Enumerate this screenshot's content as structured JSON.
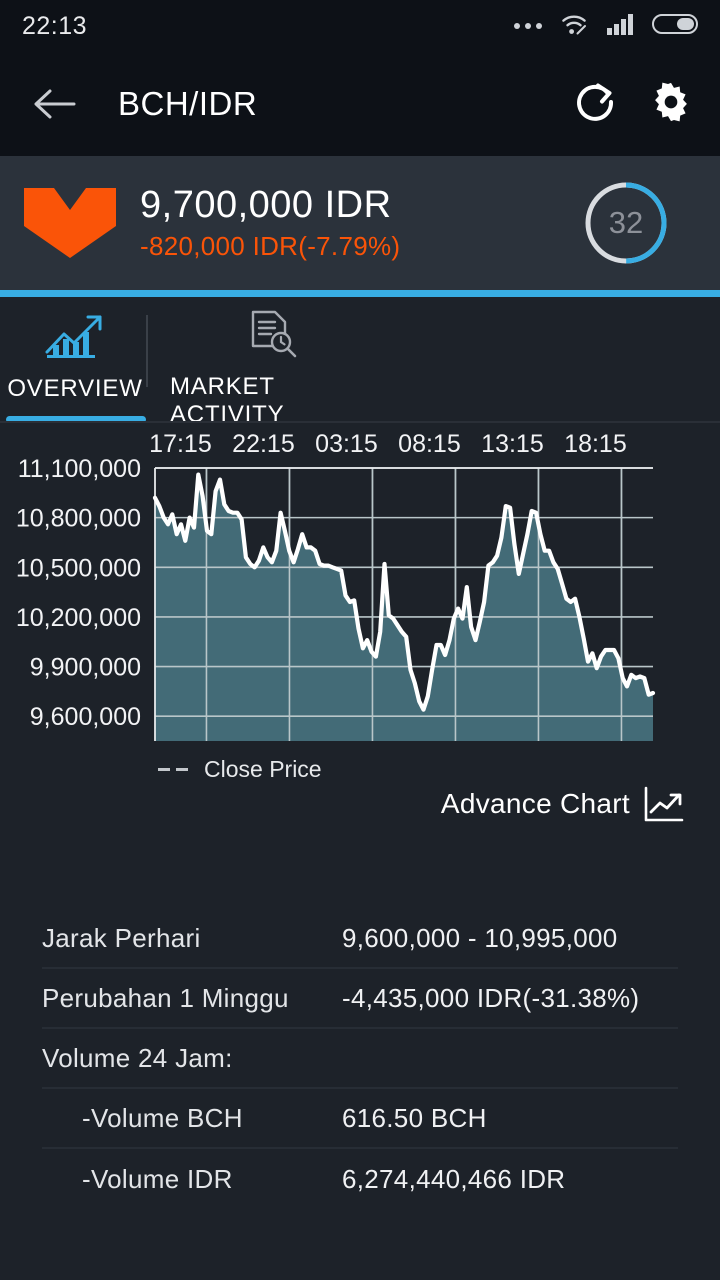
{
  "status_bar": {
    "time": "22:13",
    "icons": [
      "more-dots-icon",
      "wifi-icon",
      "signal-icon",
      "battery-icon"
    ]
  },
  "app_bar": {
    "back_icon": "back-arrow-icon",
    "title": "BCH/IDR",
    "refresh_icon": "refresh-icon",
    "settings_icon": "gear-icon"
  },
  "price_header": {
    "trend_icon": "down-chevron-icon",
    "price": "9,700,000 IDR",
    "change": "-820,000 IDR(-7.79%)",
    "change_color": "#fa5408",
    "countdown": "32",
    "countdown_progress_pct": 50,
    "accent_color": "#38ade3"
  },
  "tabs": [
    {
      "label": "OVERVIEW",
      "icon": "bar-chart-up-icon",
      "active": true
    },
    {
      "label": "MARKET ACTIVITY",
      "icon": "document-search-icon",
      "active": false
    }
  ],
  "chart_card": {
    "legend_label": "Close Price",
    "advance_chart_label": "Advance Chart",
    "advance_chart_icon": "trending-up-icon"
  },
  "chart_data": {
    "type": "area",
    "title": "",
    "xlabel": "",
    "ylabel": "",
    "series_name": "Close Price",
    "line_color": "#ffffff",
    "fill_color": "#436b77",
    "grid": true,
    "legend_position": "bottom-left",
    "ylim": [
      9450000,
      11100000
    ],
    "yticks": [
      11100000,
      10800000,
      10500000,
      10200000,
      9900000,
      9600000
    ],
    "ytick_labels": [
      "11,100,000",
      "10,800,000",
      "10,500,000",
      "10,200,000",
      "9,900,000",
      "9,600,000"
    ],
    "xtick_labels": [
      "17:15",
      "22:15",
      "03:15",
      "08:15",
      "13:15",
      "18:15"
    ],
    "values": [
      10920000,
      10870000,
      10800000,
      10760000,
      10820000,
      10700000,
      10760000,
      10660000,
      10800000,
      10740000,
      11060000,
      10930000,
      10720000,
      10700000,
      10960000,
      11030000,
      10880000,
      10840000,
      10830000,
      10830000,
      10790000,
      10560000,
      10520000,
      10500000,
      10540000,
      10620000,
      10560000,
      10530000,
      10600000,
      10830000,
      10720000,
      10600000,
      10530000,
      10610000,
      10700000,
      10620000,
      10620000,
      10600000,
      10520000,
      10510000,
      10510000,
      10500000,
      10490000,
      10480000,
      10330000,
      10290000,
      10300000,
      10130000,
      10010000,
      10060000,
      9990000,
      9960000,
      10110000,
      10520000,
      10210000,
      10190000,
      10150000,
      10110000,
      10080000,
      9880000,
      9800000,
      9690000,
      9640000,
      9720000,
      9880000,
      10030000,
      10030000,
      9970000,
      10060000,
      10190000,
      10250000,
      10190000,
      10380000,
      10140000,
      10060000,
      10170000,
      10290000,
      10510000,
      10530000,
      10570000,
      10680000,
      10870000,
      10860000,
      10640000,
      10460000,
      10580000,
      10700000,
      10840000,
      10830000,
      10700000,
      10600000,
      10600000,
      10530000,
      10490000,
      10400000,
      10310000,
      10290000,
      10310000,
      10200000,
      10070000,
      9930000,
      9980000,
      9890000,
      9960000,
      10000000,
      10000000,
      10000000,
      9950000,
      9830000,
      9780000,
      9850000,
      9830000,
      9840000,
      9830000,
      9730000,
      9740000
    ]
  },
  "stats": {
    "rows": [
      {
        "key": "Jarak Perhari",
        "value": "9,600,000 - 10,995,000",
        "indent": false
      },
      {
        "key": "Perubahan 1 Minggu",
        "value": "-4,435,000 IDR(-31.38%)",
        "indent": false
      },
      {
        "key": "Volume 24 Jam:",
        "value": "",
        "indent": false
      },
      {
        "key": "-Volume BCH",
        "value": "616.50 BCH",
        "indent": true
      },
      {
        "key": "-Volume IDR",
        "value": "6,274,440,466 IDR",
        "indent": true
      }
    ]
  }
}
